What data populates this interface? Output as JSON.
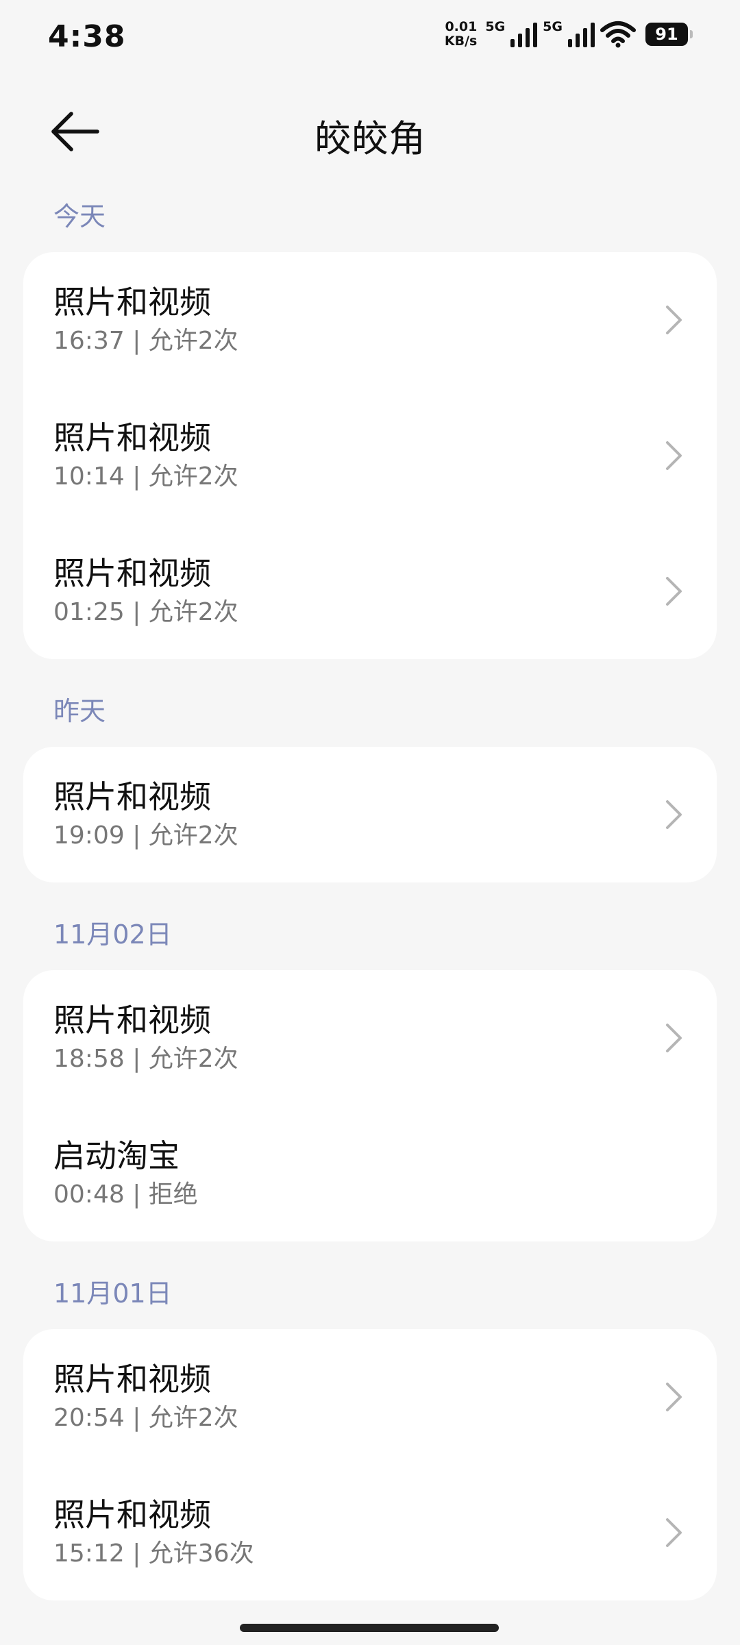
{
  "status": {
    "time": "4:38",
    "speed_value": "0.01",
    "speed_unit": "KB/s",
    "net1": "5G",
    "net2": "5G",
    "battery": "91"
  },
  "header": {
    "title": "皎皎角"
  },
  "sections": [
    {
      "label": "今天",
      "items": [
        {
          "title": "照片和视频",
          "sub": "16:37 | 允许2次",
          "chevron": true
        },
        {
          "title": "照片和视频",
          "sub": "10:14 | 允许2次",
          "chevron": true
        },
        {
          "title": "照片和视频",
          "sub": "01:25 | 允许2次",
          "chevron": true
        }
      ]
    },
    {
      "label": "昨天",
      "items": [
        {
          "title": "照片和视频",
          "sub": "19:09 | 允许2次",
          "chevron": true
        }
      ]
    },
    {
      "label": "11月02日",
      "items": [
        {
          "title": "照片和视频",
          "sub": "18:58 | 允许2次",
          "chevron": true
        },
        {
          "title": "启动淘宝",
          "sub": "00:48 | 拒绝",
          "chevron": false
        }
      ]
    },
    {
      "label": "11月01日",
      "items": [
        {
          "title": "照片和视频",
          "sub": "20:54 | 允许2次",
          "chevron": true
        },
        {
          "title": "照片和视频",
          "sub": "15:12 | 允许36次",
          "chevron": true
        }
      ]
    }
  ]
}
